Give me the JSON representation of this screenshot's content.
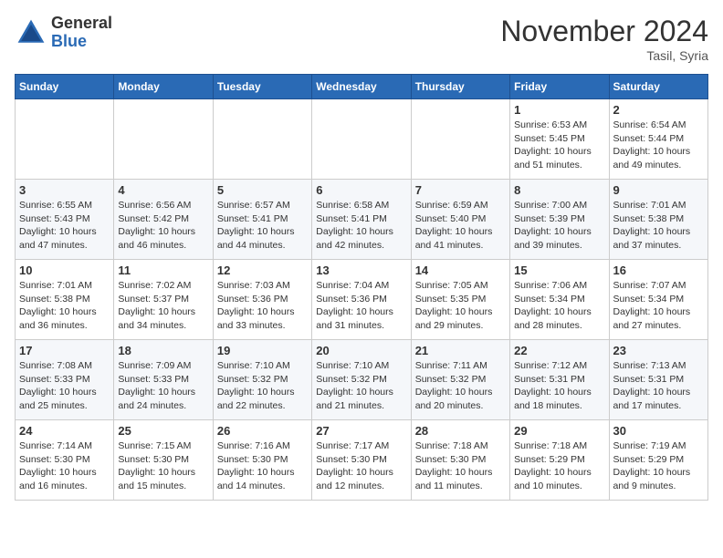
{
  "logo": {
    "general": "General",
    "blue": "Blue"
  },
  "header": {
    "month": "November 2024",
    "location": "Tasil, Syria"
  },
  "days_of_week": [
    "Sunday",
    "Monday",
    "Tuesday",
    "Wednesday",
    "Thursday",
    "Friday",
    "Saturday"
  ],
  "weeks": [
    [
      {
        "day": "",
        "info": ""
      },
      {
        "day": "",
        "info": ""
      },
      {
        "day": "",
        "info": ""
      },
      {
        "day": "",
        "info": ""
      },
      {
        "day": "",
        "info": ""
      },
      {
        "day": "1",
        "info": "Sunrise: 6:53 AM\nSunset: 5:45 PM\nDaylight: 10 hours and 51 minutes."
      },
      {
        "day": "2",
        "info": "Sunrise: 6:54 AM\nSunset: 5:44 PM\nDaylight: 10 hours and 49 minutes."
      }
    ],
    [
      {
        "day": "3",
        "info": "Sunrise: 6:55 AM\nSunset: 5:43 PM\nDaylight: 10 hours and 47 minutes."
      },
      {
        "day": "4",
        "info": "Sunrise: 6:56 AM\nSunset: 5:42 PM\nDaylight: 10 hours and 46 minutes."
      },
      {
        "day": "5",
        "info": "Sunrise: 6:57 AM\nSunset: 5:41 PM\nDaylight: 10 hours and 44 minutes."
      },
      {
        "day": "6",
        "info": "Sunrise: 6:58 AM\nSunset: 5:41 PM\nDaylight: 10 hours and 42 minutes."
      },
      {
        "day": "7",
        "info": "Sunrise: 6:59 AM\nSunset: 5:40 PM\nDaylight: 10 hours and 41 minutes."
      },
      {
        "day": "8",
        "info": "Sunrise: 7:00 AM\nSunset: 5:39 PM\nDaylight: 10 hours and 39 minutes."
      },
      {
        "day": "9",
        "info": "Sunrise: 7:01 AM\nSunset: 5:38 PM\nDaylight: 10 hours and 37 minutes."
      }
    ],
    [
      {
        "day": "10",
        "info": "Sunrise: 7:01 AM\nSunset: 5:38 PM\nDaylight: 10 hours and 36 minutes."
      },
      {
        "day": "11",
        "info": "Sunrise: 7:02 AM\nSunset: 5:37 PM\nDaylight: 10 hours and 34 minutes."
      },
      {
        "day": "12",
        "info": "Sunrise: 7:03 AM\nSunset: 5:36 PM\nDaylight: 10 hours and 33 minutes."
      },
      {
        "day": "13",
        "info": "Sunrise: 7:04 AM\nSunset: 5:36 PM\nDaylight: 10 hours and 31 minutes."
      },
      {
        "day": "14",
        "info": "Sunrise: 7:05 AM\nSunset: 5:35 PM\nDaylight: 10 hours and 29 minutes."
      },
      {
        "day": "15",
        "info": "Sunrise: 7:06 AM\nSunset: 5:34 PM\nDaylight: 10 hours and 28 minutes."
      },
      {
        "day": "16",
        "info": "Sunrise: 7:07 AM\nSunset: 5:34 PM\nDaylight: 10 hours and 27 minutes."
      }
    ],
    [
      {
        "day": "17",
        "info": "Sunrise: 7:08 AM\nSunset: 5:33 PM\nDaylight: 10 hours and 25 minutes."
      },
      {
        "day": "18",
        "info": "Sunrise: 7:09 AM\nSunset: 5:33 PM\nDaylight: 10 hours and 24 minutes."
      },
      {
        "day": "19",
        "info": "Sunrise: 7:10 AM\nSunset: 5:32 PM\nDaylight: 10 hours and 22 minutes."
      },
      {
        "day": "20",
        "info": "Sunrise: 7:10 AM\nSunset: 5:32 PM\nDaylight: 10 hours and 21 minutes."
      },
      {
        "day": "21",
        "info": "Sunrise: 7:11 AM\nSunset: 5:32 PM\nDaylight: 10 hours and 20 minutes."
      },
      {
        "day": "22",
        "info": "Sunrise: 7:12 AM\nSunset: 5:31 PM\nDaylight: 10 hours and 18 minutes."
      },
      {
        "day": "23",
        "info": "Sunrise: 7:13 AM\nSunset: 5:31 PM\nDaylight: 10 hours and 17 minutes."
      }
    ],
    [
      {
        "day": "24",
        "info": "Sunrise: 7:14 AM\nSunset: 5:30 PM\nDaylight: 10 hours and 16 minutes."
      },
      {
        "day": "25",
        "info": "Sunrise: 7:15 AM\nSunset: 5:30 PM\nDaylight: 10 hours and 15 minutes."
      },
      {
        "day": "26",
        "info": "Sunrise: 7:16 AM\nSunset: 5:30 PM\nDaylight: 10 hours and 14 minutes."
      },
      {
        "day": "27",
        "info": "Sunrise: 7:17 AM\nSunset: 5:30 PM\nDaylight: 10 hours and 12 minutes."
      },
      {
        "day": "28",
        "info": "Sunrise: 7:18 AM\nSunset: 5:30 PM\nDaylight: 10 hours and 11 minutes."
      },
      {
        "day": "29",
        "info": "Sunrise: 7:18 AM\nSunset: 5:29 PM\nDaylight: 10 hours and 10 minutes."
      },
      {
        "day": "30",
        "info": "Sunrise: 7:19 AM\nSunset: 5:29 PM\nDaylight: 10 hours and 9 minutes."
      }
    ]
  ]
}
